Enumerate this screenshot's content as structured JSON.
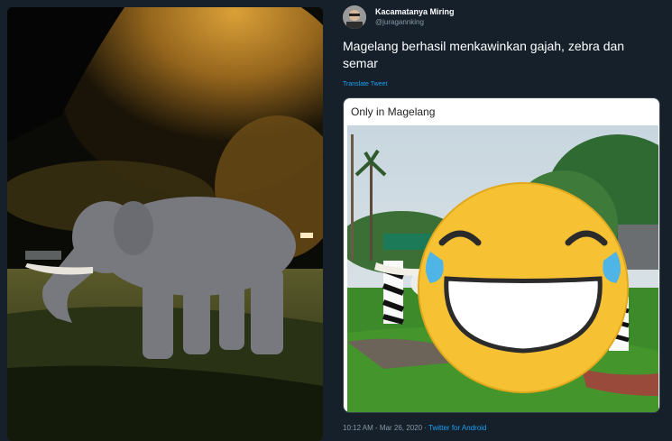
{
  "tweet": {
    "display_name": "Kacamatanya Miring",
    "handle": "@juragannking",
    "text": "Magelang berhasil menkawinkan gajah, zebra dan semar",
    "translate_link": "Translate Tweet",
    "embedded_card_title": "Only in Magelang",
    "timestamp": "10:12 AM - Mar 26, 2020",
    "separator": " · ",
    "source": "Twitter for Android"
  },
  "colors": {
    "background": "#15202b",
    "link": "#1da1f2",
    "muted": "#8899a6",
    "emoji_face": "#f6c234",
    "emoji_tears": "#4fb5e6"
  },
  "icons": [
    "laughing-tears-emoji-icon",
    "avatar-photo"
  ]
}
